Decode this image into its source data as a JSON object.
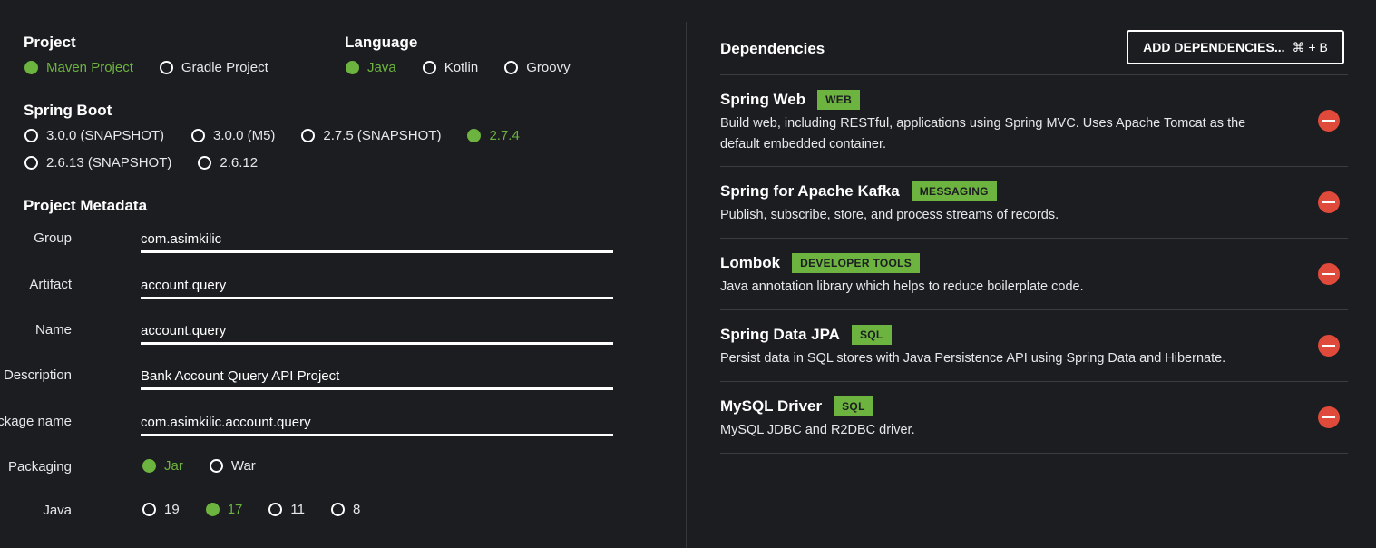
{
  "project": {
    "title": "Project",
    "options": [
      {
        "label": "Maven Project",
        "selected": true
      },
      {
        "label": "Gradle Project",
        "selected": false
      }
    ]
  },
  "language": {
    "title": "Language",
    "options": [
      {
        "label": "Java",
        "selected": true
      },
      {
        "label": "Kotlin",
        "selected": false
      },
      {
        "label": "Groovy",
        "selected": false
      }
    ]
  },
  "spring_boot": {
    "title": "Spring Boot",
    "options": [
      {
        "label": "3.0.0 (SNAPSHOT)",
        "selected": false
      },
      {
        "label": "3.0.0 (M5)",
        "selected": false
      },
      {
        "label": "2.7.5 (SNAPSHOT)",
        "selected": false
      },
      {
        "label": "2.7.4",
        "selected": true
      },
      {
        "label": "2.6.13 (SNAPSHOT)",
        "selected": false
      },
      {
        "label": "2.6.12",
        "selected": false
      }
    ]
  },
  "metadata": {
    "title": "Project Metadata",
    "fields": {
      "group": {
        "label": "Group",
        "value": "com.asimkilic"
      },
      "artifact": {
        "label": "Artifact",
        "value": "account.query"
      },
      "name": {
        "label": "Name",
        "value": "account.query"
      },
      "description": {
        "label": "Description",
        "value": "Bank Account Qıuery API Project"
      },
      "package_name": {
        "label": "Package name",
        "value": "com.asimkilic.account.query"
      }
    },
    "packaging": {
      "label": "Packaging",
      "options": [
        {
          "label": "Jar",
          "selected": true
        },
        {
          "label": "War",
          "selected": false
        }
      ]
    },
    "java": {
      "label": "Java",
      "options": [
        {
          "label": "19",
          "selected": false
        },
        {
          "label": "17",
          "selected": true
        },
        {
          "label": "11",
          "selected": false
        },
        {
          "label": "8",
          "selected": false
        }
      ]
    }
  },
  "dependencies": {
    "title": "Dependencies",
    "add_button_label": "ADD DEPENDENCIES...",
    "add_button_shortcut": "⌘ + B",
    "items": [
      {
        "name": "Spring Web",
        "tag": "WEB",
        "description": "Build web, including RESTful, applications using Spring MVC. Uses Apache Tomcat as the default embedded container."
      },
      {
        "name": "Spring for Apache Kafka",
        "tag": "MESSAGING",
        "description": "Publish, subscribe, store, and process streams of records."
      },
      {
        "name": "Lombok",
        "tag": "DEVELOPER TOOLS",
        "description": "Java annotation library which helps to reduce boilerplate code."
      },
      {
        "name": "Spring Data JPA",
        "tag": "SQL",
        "description": "Persist data in SQL stores with Java Persistence API using Spring Data and Hibernate."
      },
      {
        "name": "MySQL Driver",
        "tag": "SQL",
        "description": "MySQL JDBC and R2DBC driver."
      }
    ]
  },
  "colors": {
    "background": "#1b1d20",
    "accent": "#6db33f",
    "remove": "#e04a3a",
    "text": "#ffffff"
  }
}
